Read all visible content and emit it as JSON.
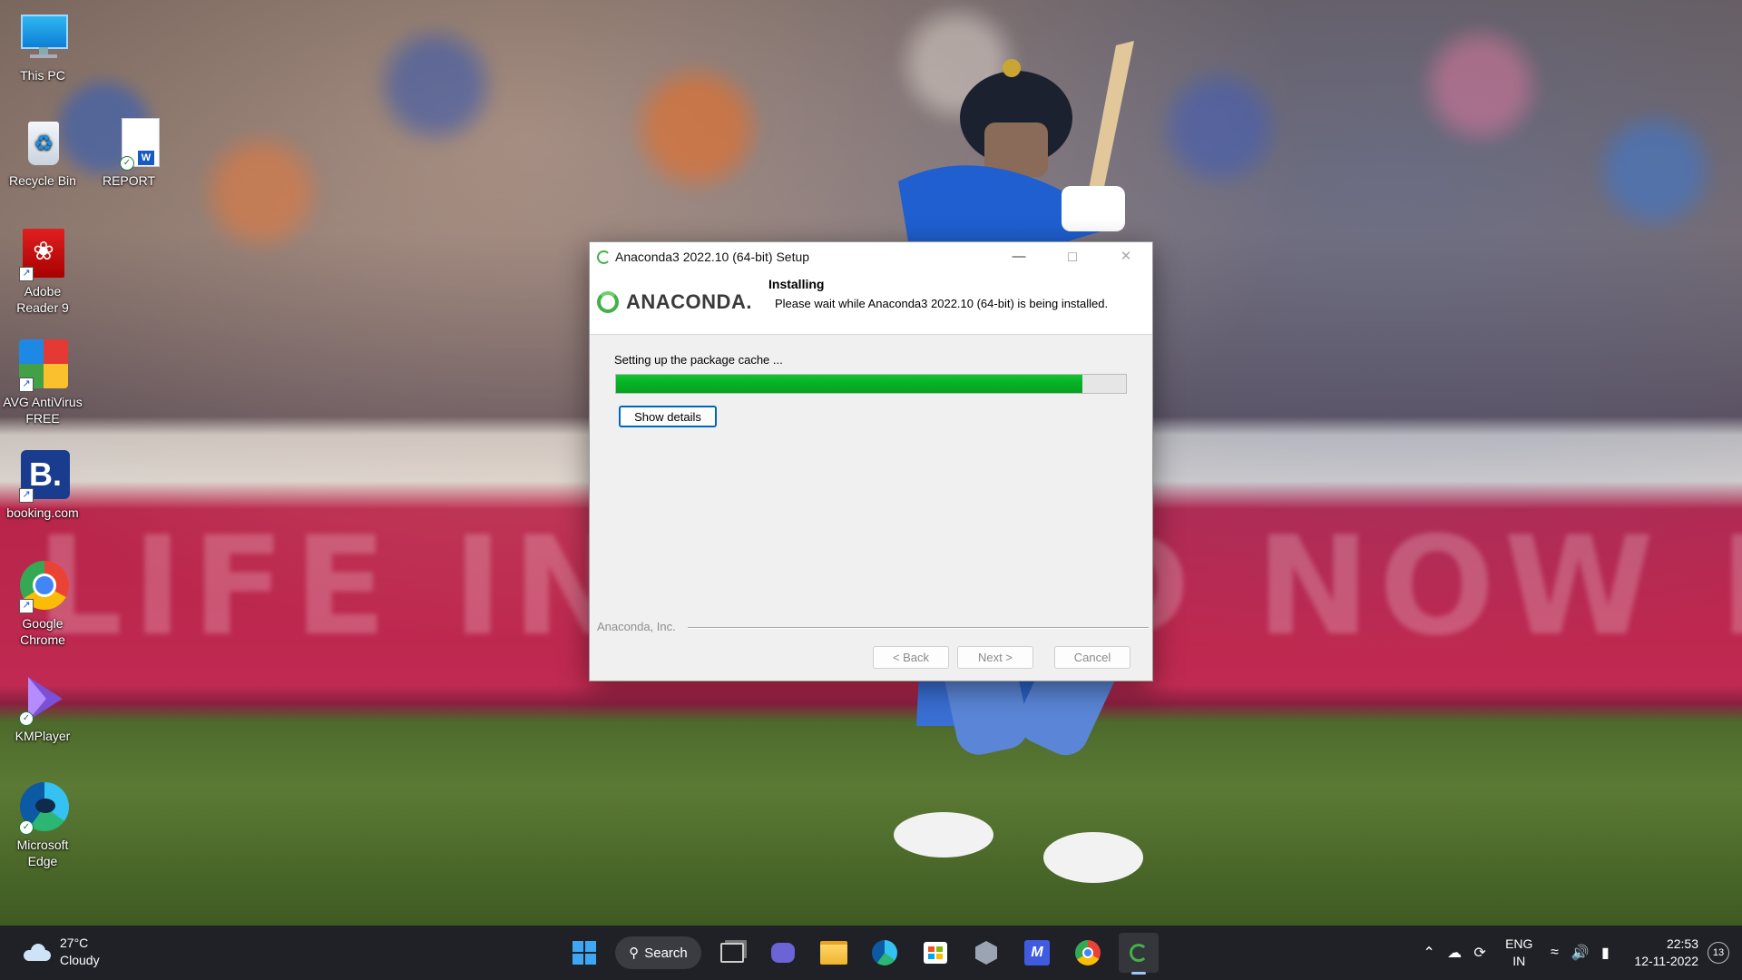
{
  "desktop": {
    "icons": [
      {
        "label": "This PC"
      },
      {
        "label": "Recycle Bin"
      },
      {
        "label": "REPORT"
      },
      {
        "label": "Adobe\nReader 9"
      },
      {
        "label": "AVG AntiVirus\nFREE"
      },
      {
        "label": "booking.com"
      },
      {
        "label": "Google\nChrome"
      },
      {
        "label": "KMPlayer"
      },
      {
        "label": "Microsoft\nEdge"
      }
    ]
  },
  "dialog": {
    "title": "Anaconda3 2022.10 (64-bit) Setup",
    "logo_text": "ANACONDA.",
    "heading": "Installing",
    "subheading": "Please wait while Anaconda3 2022.10 (64-bit) is being installed.",
    "status": "Setting up the package cache ...",
    "progress": 0.915,
    "show_details_label": "Show details",
    "footer_label": "Anaconda, Inc.",
    "back_label": "< Back",
    "next_label": "Next >",
    "cancel_label": "Cancel",
    "accent": "#43b049",
    "progress_color": "#06b025"
  },
  "taskbar": {
    "weather_temp": "27°C",
    "weather_cond": "Cloudy",
    "search_label": "Search",
    "lang_line1": "ENG",
    "lang_line2": "IN",
    "time": "22:53",
    "date": "12-11-2022",
    "notification_count": "13"
  }
}
